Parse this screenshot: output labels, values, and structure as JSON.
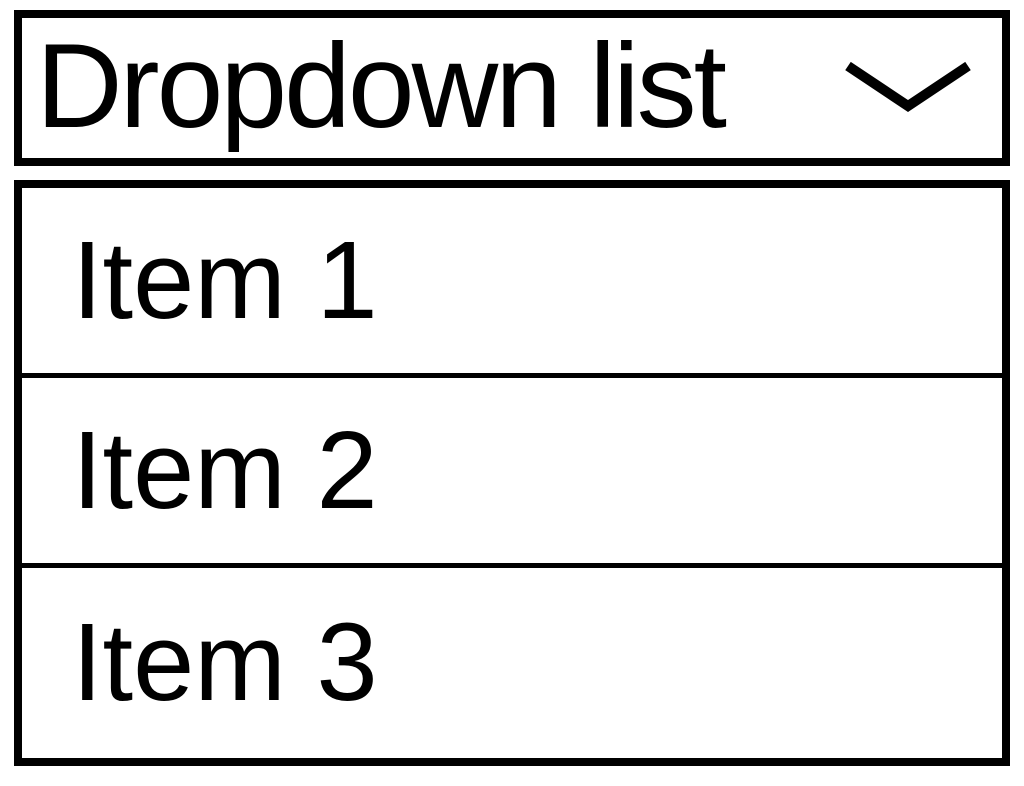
{
  "dropdown": {
    "label": "Dropdown list",
    "items": [
      {
        "label": "Item 1"
      },
      {
        "label": "Item 2"
      },
      {
        "label": "Item 3"
      }
    ]
  }
}
